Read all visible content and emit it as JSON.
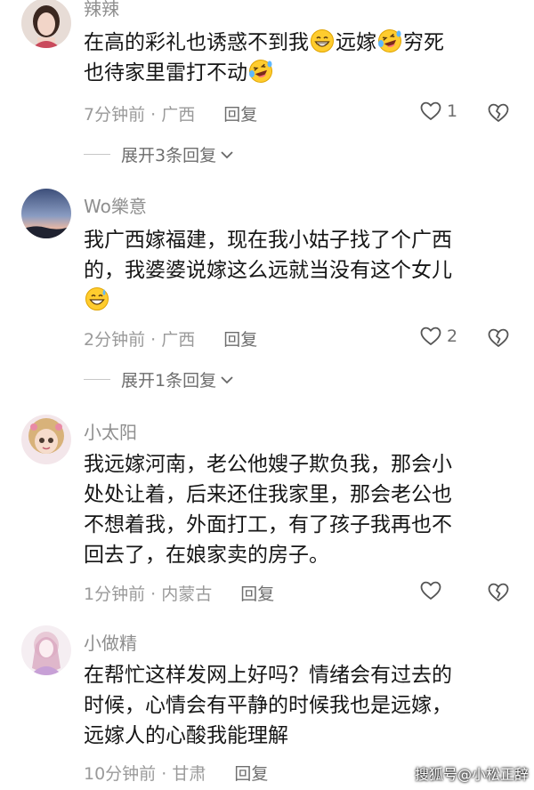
{
  "comments": [
    {
      "username": "辣辣",
      "lines": [
        [
          {
            "text": "在高的彩礼也诱惑不到我"
          },
          {
            "emoji": "grin-emoji"
          },
          {
            "text": "远嫁"
          },
          {
            "emoji": "laugh-cry-emoji"
          },
          {
            "text": "穷死"
          }
        ],
        [
          {
            "text": "也待家里雷打不动"
          },
          {
            "emoji": "laugh-cry-emoji"
          }
        ]
      ],
      "time": "7分钟前",
      "sep": "·",
      "location": "广西",
      "reply_label": "回复",
      "likes": "1",
      "expand_label": "展开3条回复"
    },
    {
      "username": "Wo樂意",
      "lines": [
        [
          {
            "text": "我广西嫁福建，现在我小姑子找了个广西"
          }
        ],
        [
          {
            "text": "的，我婆婆说嫁这么远就当没有这个女儿"
          }
        ],
        [
          {
            "emoji": "sweat-smile-emoji"
          }
        ]
      ],
      "time": "2分钟前",
      "sep": "·",
      "location": "广西",
      "reply_label": "回复",
      "likes": "2",
      "expand_label": "展开1条回复"
    },
    {
      "username": "小太阳",
      "lines": [
        [
          {
            "text": "我远嫁河南，老公他嫂子欺负我，那会小"
          }
        ],
        [
          {
            "text": "处处让着，后来还住我家里，那会老公也"
          }
        ],
        [
          {
            "text": "不想着我，外面打工，有了孩子我再也不"
          }
        ],
        [
          {
            "text": "回去了，在娘家卖的房子。"
          }
        ]
      ],
      "time": "1分钟前",
      "sep": "·",
      "location": "内蒙古",
      "reply_label": "回复",
      "likes": ""
    },
    {
      "username": "小做精",
      "lines": [
        [
          {
            "text": "在帮忙这样发网上好吗？情绪会有过去的"
          }
        ],
        [
          {
            "text": "时候，心情会有平静的时候我也是远嫁，"
          }
        ],
        [
          {
            "text": "远嫁人的心酸我能理解"
          }
        ]
      ],
      "time": "10分钟前",
      "sep": "·",
      "location": "甘肃",
      "reply_label": "回复",
      "likes": ""
    }
  ],
  "watermark": "搜狐号@小松正辞",
  "colors": {
    "text": "#161616",
    "meta": "#9a9a9a",
    "username": "#8e8e8e",
    "divider": "#c8c8c8"
  }
}
